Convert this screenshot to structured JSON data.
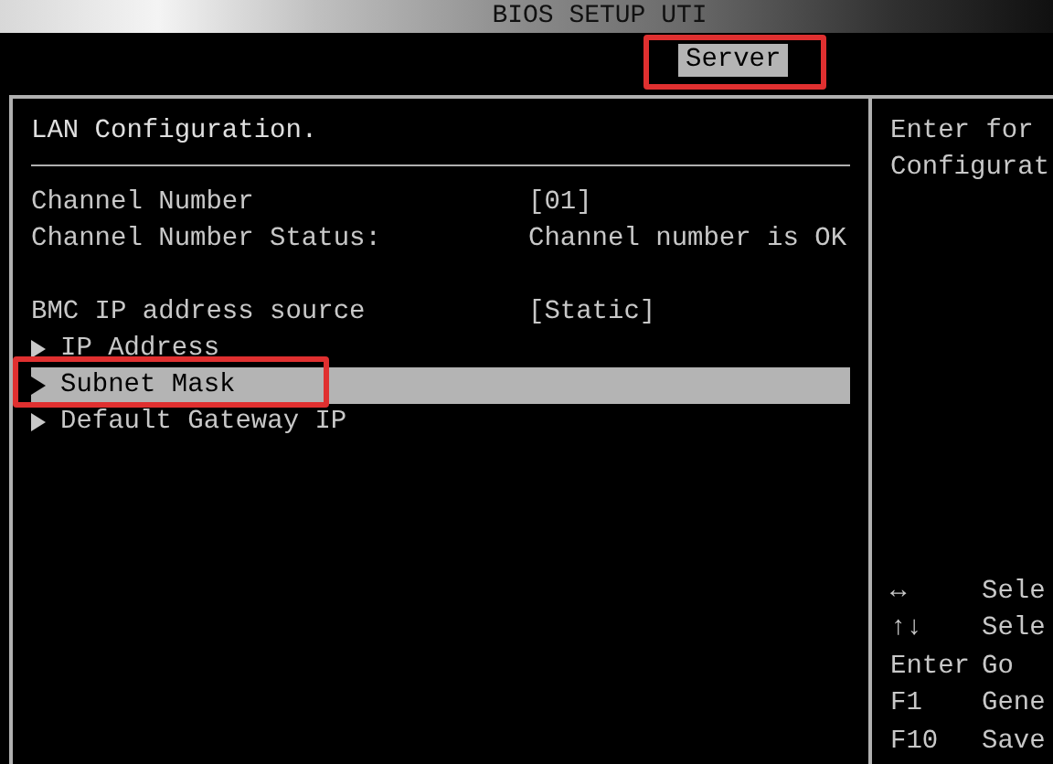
{
  "header": {
    "title": "BIOS SETUP UTI"
  },
  "tabs": [
    {
      "label": "Server",
      "selected": true,
      "annotated": true
    }
  ],
  "main": {
    "heading": "LAN Configuration.",
    "groups": [
      [
        {
          "kind": "setting",
          "label": "Channel Number",
          "value": "[01]"
        },
        {
          "kind": "setting",
          "label": "Channel Number Status:",
          "value": "Channel number is OK"
        }
      ],
      [
        {
          "kind": "setting",
          "label": "BMC IP address source",
          "value": "[Static]"
        },
        {
          "kind": "submenu",
          "label": "IP Address",
          "selected": false,
          "annotated": false
        },
        {
          "kind": "submenu",
          "label": "Subnet Mask",
          "selected": true,
          "annotated": true
        },
        {
          "kind": "submenu",
          "label": "Default Gateway IP",
          "selected": false,
          "annotated": false
        }
      ]
    ]
  },
  "help": {
    "lines": [
      "Enter for",
      "Configurat"
    ],
    "keys": [
      {
        "key": "↔",
        "action": "Sele"
      },
      {
        "key": "↑↓",
        "action": "Sele"
      },
      {
        "key": "Enter",
        "action": "Go"
      },
      {
        "key": "F1",
        "action": "Gene"
      },
      {
        "key": "F10",
        "action": "Save"
      }
    ]
  }
}
